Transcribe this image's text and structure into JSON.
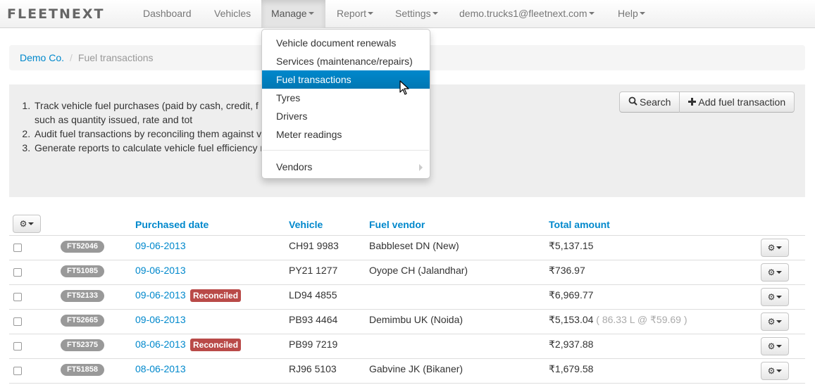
{
  "brand": "FLEETNEXT",
  "nav": {
    "dashboard": "Dashboard",
    "vehicles": "Vehicles",
    "manage": "Manage",
    "report": "Report",
    "settings": "Settings",
    "user": "demo.trucks1@fleetnext.com",
    "help": "Help"
  },
  "breadcrumb": {
    "company": "Demo Co.",
    "sep": "/",
    "current": "Fuel transactions"
  },
  "info": {
    "items": [
      "Track vehicle fuel purchases (paid by cash, credit, f capture details such as quantity issued, rate and tot",
      "Audit fuel transactions by reconciling them against v statements.",
      "Generate reports to calculate vehicle fuel efficiency mi)."
    ]
  },
  "buttons": {
    "search": "Search",
    "add": "Add fuel transaction"
  },
  "table": {
    "headers": {
      "date": "Purchased date",
      "vehicle": "Vehicle",
      "vendor": "Fuel vendor",
      "amount": "Total amount"
    },
    "reconciled_label": "Reconciled",
    "rows": [
      {
        "id": "FT52046",
        "date": "09-06-2013",
        "reconciled": false,
        "vehicle": "CH91 9983",
        "vendor": "Babbleset DN (New)",
        "amount": "₹5,137.15",
        "note": ""
      },
      {
        "id": "FT51085",
        "date": "09-06-2013",
        "reconciled": false,
        "vehicle": "PY21 1277",
        "vendor": "Oyope CH (Jalandhar)",
        "amount": "₹736.97",
        "note": ""
      },
      {
        "id": "FT52133",
        "date": "09-06-2013",
        "reconciled": true,
        "vehicle": "LD94 4855",
        "vendor": "",
        "amount": "₹6,969.77",
        "note": ""
      },
      {
        "id": "FT52665",
        "date": "09-06-2013",
        "reconciled": false,
        "vehicle": "PB93 4464",
        "vendor": "Demimbu UK (Noida)",
        "amount": "₹5,153.04",
        "note": " ( 86.33 L @ ₹59.69 )"
      },
      {
        "id": "FT52375",
        "date": "08-06-2013",
        "reconciled": true,
        "vehicle": "PB99 7219",
        "vendor": "",
        "amount": "₹2,937.88",
        "note": ""
      },
      {
        "id": "FT51858",
        "date": "08-06-2013",
        "reconciled": false,
        "vehicle": "RJ96 5103",
        "vendor": "Gabvine JK (Bikaner)",
        "amount": "₹1,679.58",
        "note": ""
      }
    ]
  },
  "dropdown": {
    "items": [
      "Vehicle document renewals",
      "Services (maintenance/repairs)",
      "Fuel transactions",
      "Tyres",
      "Drivers",
      "Meter readings"
    ],
    "active": "Fuel transactions",
    "vendors": "Vendors"
  }
}
